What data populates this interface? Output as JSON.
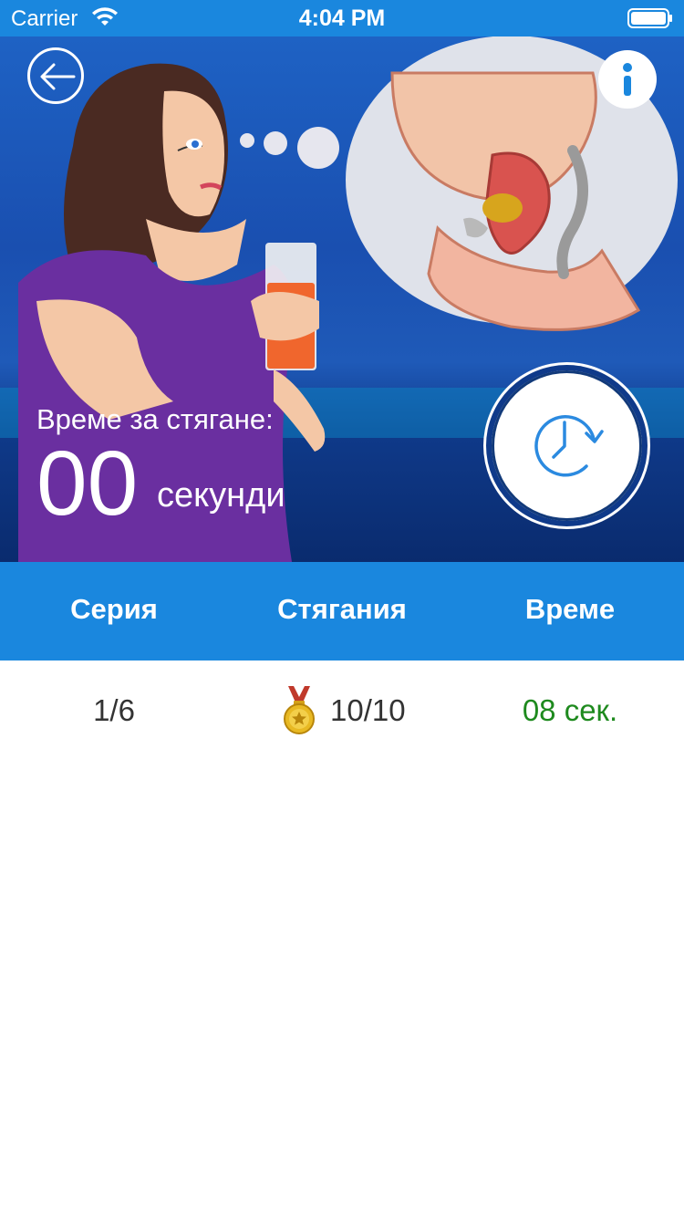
{
  "status_bar": {
    "carrier": "Carrier",
    "time": "4:04 PM",
    "wifi_icon": "wifi-icon",
    "battery_icon": "battery-icon"
  },
  "hero": {
    "back_icon": "arrow-left-icon",
    "info_icon": "info-icon",
    "timer_label": "Време за стягане:",
    "timer_value": "00",
    "timer_unit": "секунди",
    "restart_icon": "clock-restart-icon"
  },
  "table": {
    "columns": [
      "Серия",
      "Стягания",
      "Време"
    ],
    "rows": [
      {
        "series": "1/6",
        "medal_icon": "medal-icon",
        "count": "10/10",
        "time": "08 сек."
      }
    ]
  },
  "colors": {
    "accent": "#1a87de",
    "hero_dark": "#0a2b6e",
    "time_green": "#1e8a1e"
  }
}
